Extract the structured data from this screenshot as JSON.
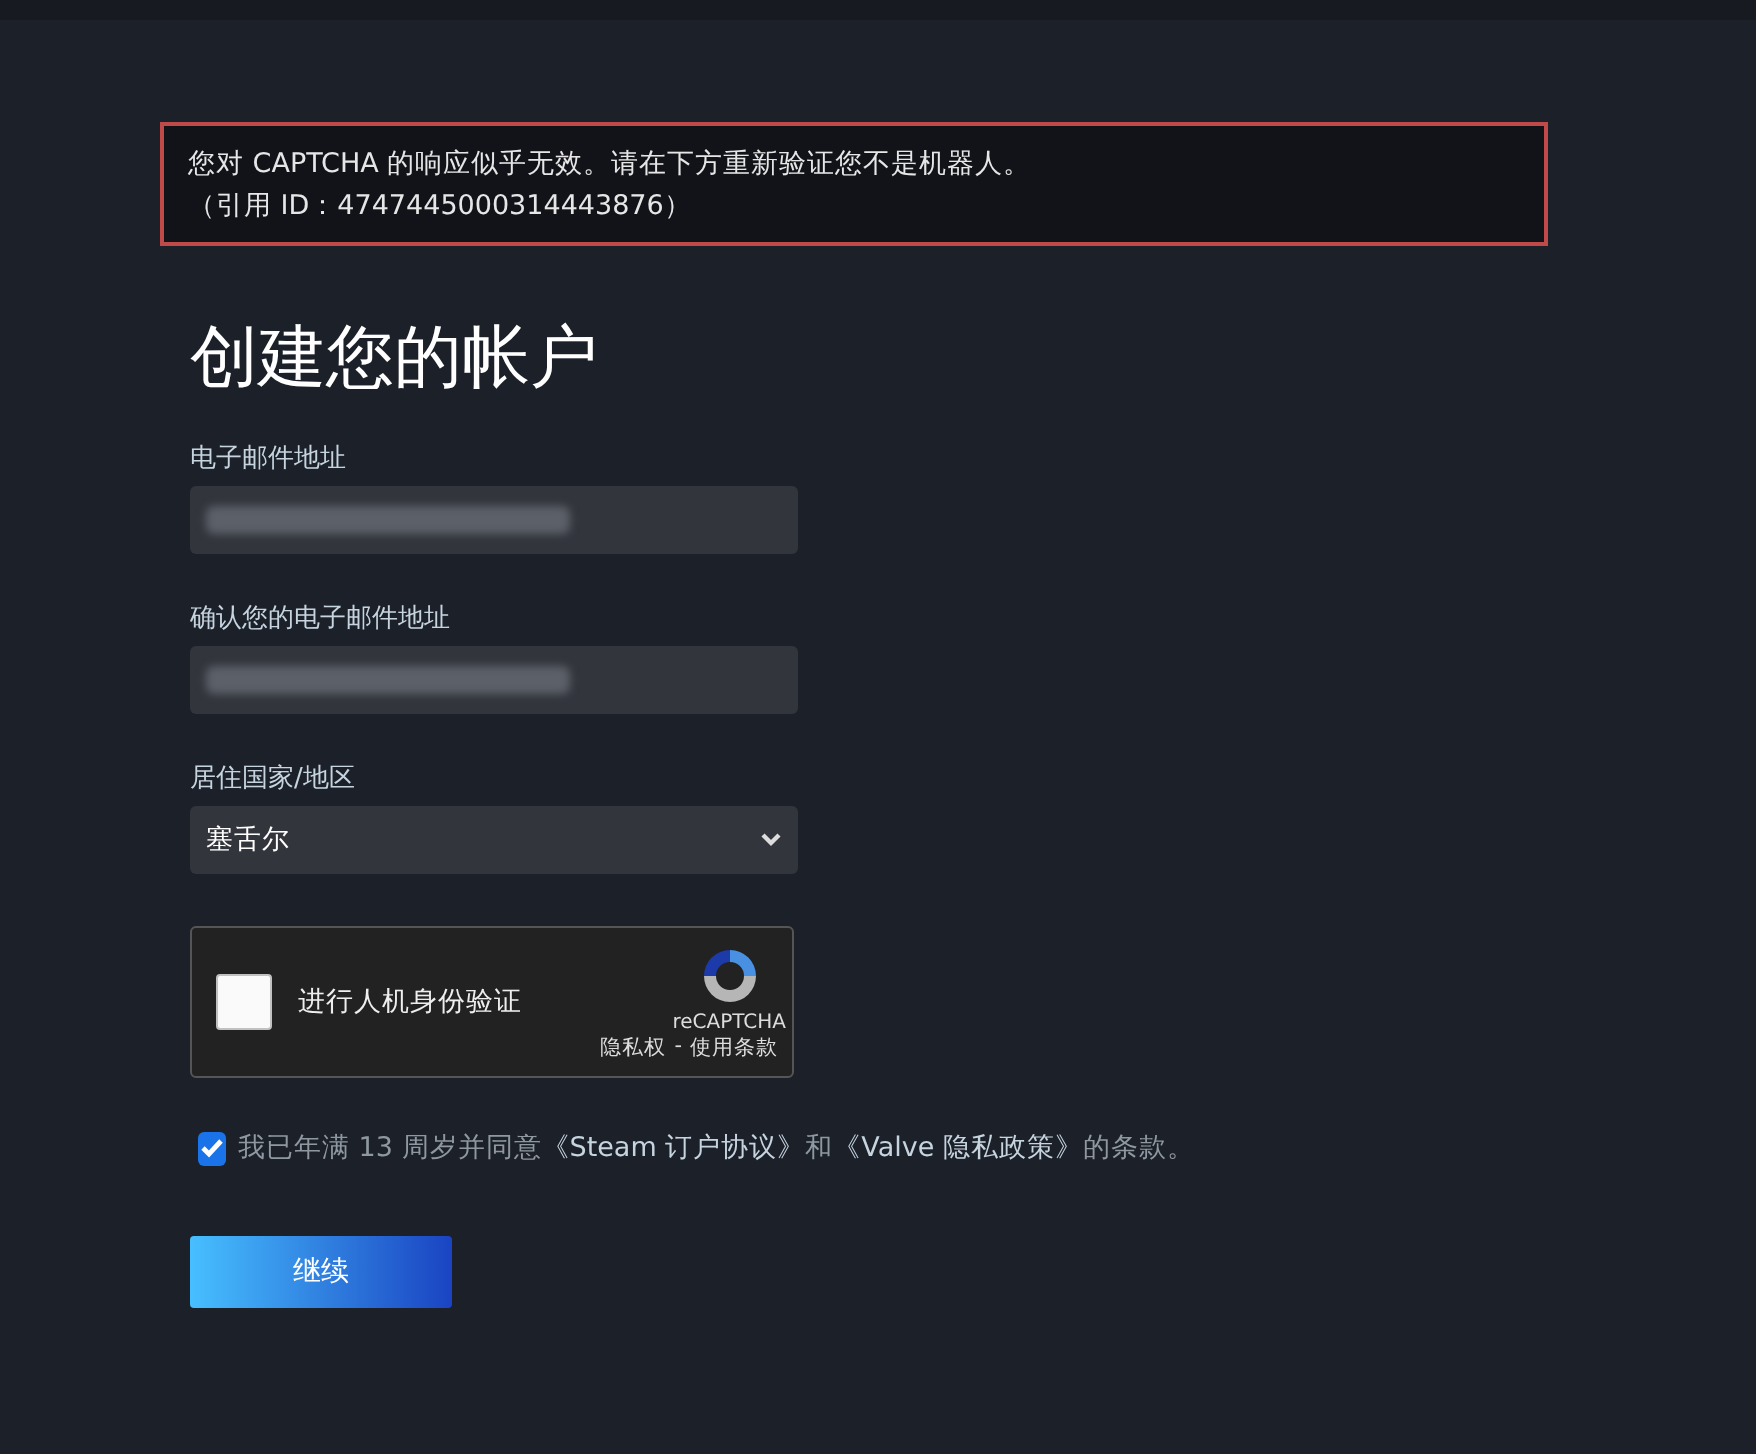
{
  "error": {
    "lines": [
      "您对 CAPTCHA 的响应似乎无效。请在下方重新验证您不是机器人。",
      "（引用 ID：4747445000314443876）"
    ]
  },
  "heading": "创建您的帐户",
  "fields": [
    {
      "kind": "text",
      "label": "电子邮件地址"
    },
    {
      "kind": "text",
      "label": "确认您的电子邮件地址"
    },
    {
      "kind": "select",
      "label": "居住国家/地区",
      "value": "塞舌尔"
    }
  ],
  "captcha": {
    "checked": false,
    "label": "进行人机身份验证",
    "brand": "reCAPTCHA",
    "links": [
      "隐私权",
      "-",
      "使用条款"
    ]
  },
  "agreement": {
    "checked": true,
    "parts": [
      {
        "kind": "text",
        "text": "我已年满 13 周岁并同意"
      },
      {
        "kind": "link",
        "text": "《Steam 订户协议》"
      },
      {
        "kind": "text",
        "text": "和"
      },
      {
        "kind": "link",
        "text": "《Valve 隐私政策》"
      },
      {
        "kind": "text",
        "text": "的条款。"
      }
    ]
  },
  "continue_button": "继续"
}
